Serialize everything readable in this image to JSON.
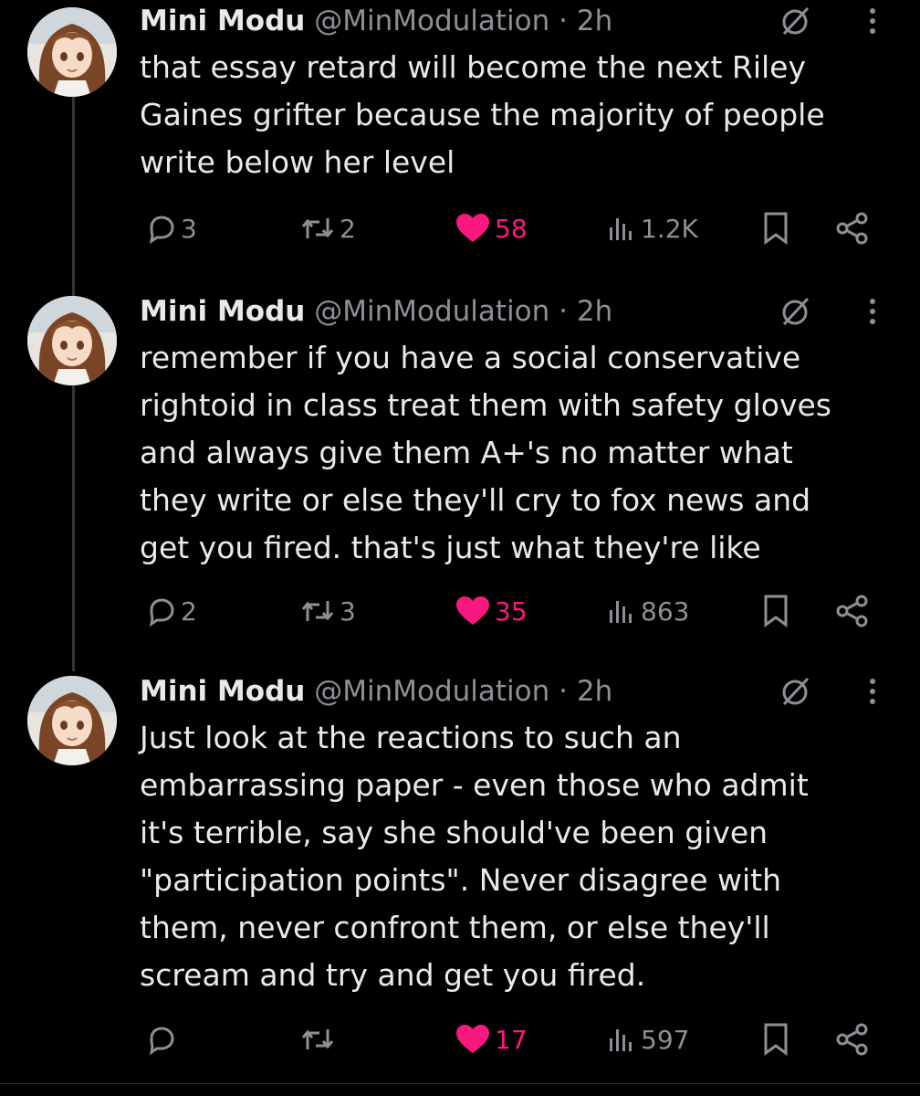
{
  "tweets": [
    {
      "author_name": "Mini Modu",
      "handle": "@MinModulation",
      "separator": "·",
      "time": "2h",
      "text": "that essay retard will become the next Riley\nGaines grifter because the majority of people\nwrite below her level",
      "replies": "3",
      "reposts": "2",
      "likes": "58",
      "views": "1.2K",
      "liked": true
    },
    {
      "author_name": "Mini Modu",
      "handle": "@MinModulation",
      "separator": "·",
      "time": "2h",
      "text": "remember if you have a social conservative\nrightoid in class treat them with safety gloves\nand always give them A+'s no matter what\nthey write or else they'll cry to fox news and\nget you fired. that's just what they're like",
      "replies": "2",
      "reposts": "3",
      "likes": "35",
      "views": "863",
      "liked": true
    },
    {
      "author_name": "Mini Modu",
      "handle": "@MinModulation",
      "separator": "·",
      "time": "2h",
      "text": "Just look at the reactions to such an\nembarrassing paper - even those who admit\nit's terrible, say she should've been given\n\"participation points\". Never disagree with\nthem, never confront them, or else they'll\nscream and try and get you fired.",
      "replies": "",
      "reposts": "",
      "likes": "17",
      "views": "597",
      "liked": true
    }
  ],
  "colors": {
    "background": "#000000",
    "text": "#e7e9ea",
    "secondary": "#8b9096",
    "like": "#f91880",
    "thread_line": "#333639"
  },
  "icons": [
    "reply-icon",
    "repost-icon",
    "heart-icon",
    "views-icon",
    "bookmark-icon",
    "share-icon",
    "grok-icon",
    "more-icon"
  ]
}
